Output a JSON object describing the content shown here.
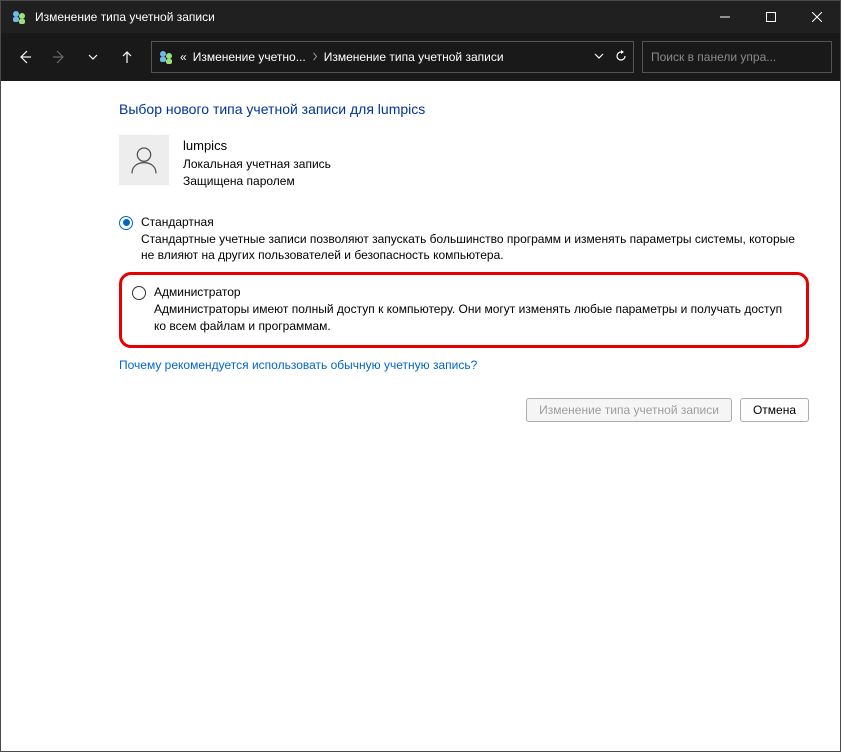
{
  "titlebar": {
    "title": "Изменение типа учетной записи"
  },
  "breadcrumb": {
    "prefix": "«",
    "item1": "Изменение учетно...",
    "item2": "Изменение типа учетной записи"
  },
  "search": {
    "placeholder": "Поиск в панели упра..."
  },
  "content": {
    "heading": "Выбор нового типа учетной записи для lumpics",
    "user": {
      "name": "lumpics",
      "line1": "Локальная учетная запись",
      "line2": "Защищена паролем"
    },
    "options": {
      "standard": {
        "label": "Стандартная",
        "desc": "Стандартные учетные записи позволяют запускать большинство программ и изменять параметры системы, которые не влияют на других пользователей и безопасность компьютера."
      },
      "admin": {
        "label": "Администратор",
        "desc": "Администраторы имеют полный доступ к компьютеру. Они могут изменять любые параметры и получать доступ ко всем файлам и программам."
      }
    },
    "help_link": "Почему рекомендуется использовать обычную учетную запись?",
    "buttons": {
      "change": "Изменение типа учетной записи",
      "cancel": "Отмена"
    }
  }
}
